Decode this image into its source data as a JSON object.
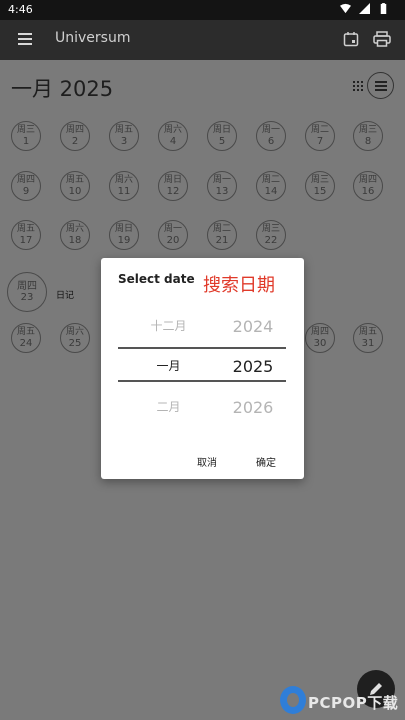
{
  "status_bar": {
    "time": "4:46"
  },
  "app_bar": {
    "title": "Universum"
  },
  "month_header": {
    "title": "一月 2025"
  },
  "calendar": {
    "days": [
      {
        "weekday": "周三",
        "day": "1"
      },
      {
        "weekday": "周四",
        "day": "2"
      },
      {
        "weekday": "周五",
        "day": "3"
      },
      {
        "weekday": "周六",
        "day": "4"
      },
      {
        "weekday": "周日",
        "day": "5"
      },
      {
        "weekday": "周一",
        "day": "6"
      },
      {
        "weekday": "周二",
        "day": "7"
      },
      {
        "weekday": "周三",
        "day": "8"
      },
      {
        "weekday": "周四",
        "day": "9"
      },
      {
        "weekday": "周五",
        "day": "10"
      },
      {
        "weekday": "周六",
        "day": "11"
      },
      {
        "weekday": "周日",
        "day": "12"
      },
      {
        "weekday": "周一",
        "day": "13"
      },
      {
        "weekday": "周二",
        "day": "14"
      },
      {
        "weekday": "周三",
        "day": "15"
      },
      {
        "weekday": "周四",
        "day": "16"
      },
      {
        "weekday": "周五",
        "day": "17"
      },
      {
        "weekday": "周六",
        "day": "18"
      },
      {
        "weekday": "周日",
        "day": "19"
      },
      {
        "weekday": "周一",
        "day": "20"
      },
      {
        "weekday": "周二",
        "day": "21"
      },
      {
        "weekday": "周三",
        "day": "22"
      },
      {
        "weekday": "周四",
        "day": "23"
      },
      {
        "weekday": "周五",
        "day": "24"
      },
      {
        "weekday": "周六",
        "day": "25"
      },
      {
        "weekday": "周四",
        "day": "30"
      },
      {
        "weekday": "周五",
        "day": "31"
      }
    ],
    "diary_label": "日记"
  },
  "dialog": {
    "title": "Select date",
    "annotation": "搜索日期",
    "rows": [
      {
        "month": "十二月",
        "year": "2024"
      },
      {
        "month": "一月",
        "year": "2025"
      },
      {
        "month": "二月",
        "year": "2026"
      }
    ],
    "cancel_label": "取消",
    "confirm_label": "确定"
  },
  "watermark": {
    "text": "PCPOP下载"
  },
  "colors": {
    "annotation": "#e03a2a",
    "app_bar": "#2c2c2c",
    "fab": "#1f1f1f"
  }
}
